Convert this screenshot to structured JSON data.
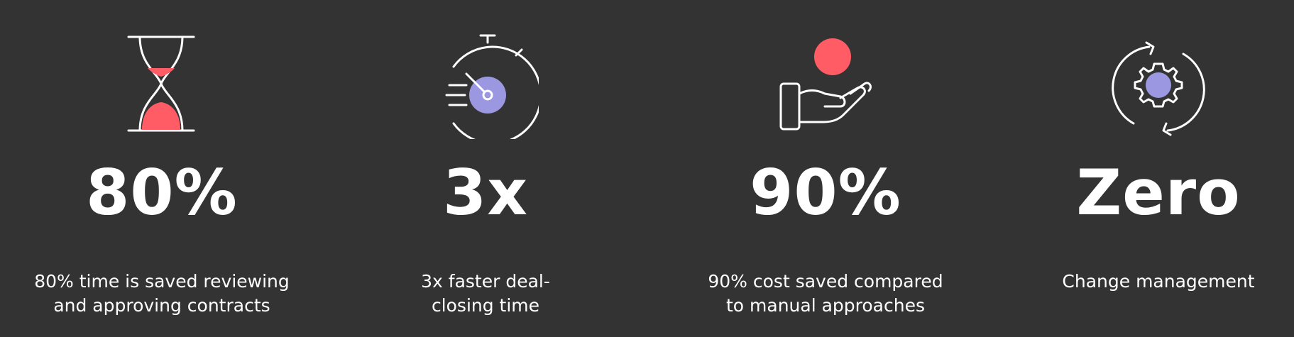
{
  "colors": {
    "background": "#333333",
    "text": "#ffffff",
    "accent_red": "#ff5c66",
    "accent_purple": "#9b97e0",
    "icon_stroke": "#ffffff"
  },
  "stats": [
    {
      "icon": "hourglass-icon",
      "value": "80%",
      "caption_lines": [
        "80% time is saved reviewing",
        "and approving contracts"
      ]
    },
    {
      "icon": "stopwatch-icon",
      "value": "3x",
      "caption_lines": [
        "3x faster deal-",
        "closing time"
      ]
    },
    {
      "icon": "hand-coin-icon",
      "value": "90%",
      "caption_lines": [
        "90% cost saved compared",
        "to manual approaches"
      ]
    },
    {
      "icon": "gear-cycle-icon",
      "value": "Zero",
      "caption_lines": [
        "Change management"
      ]
    }
  ]
}
